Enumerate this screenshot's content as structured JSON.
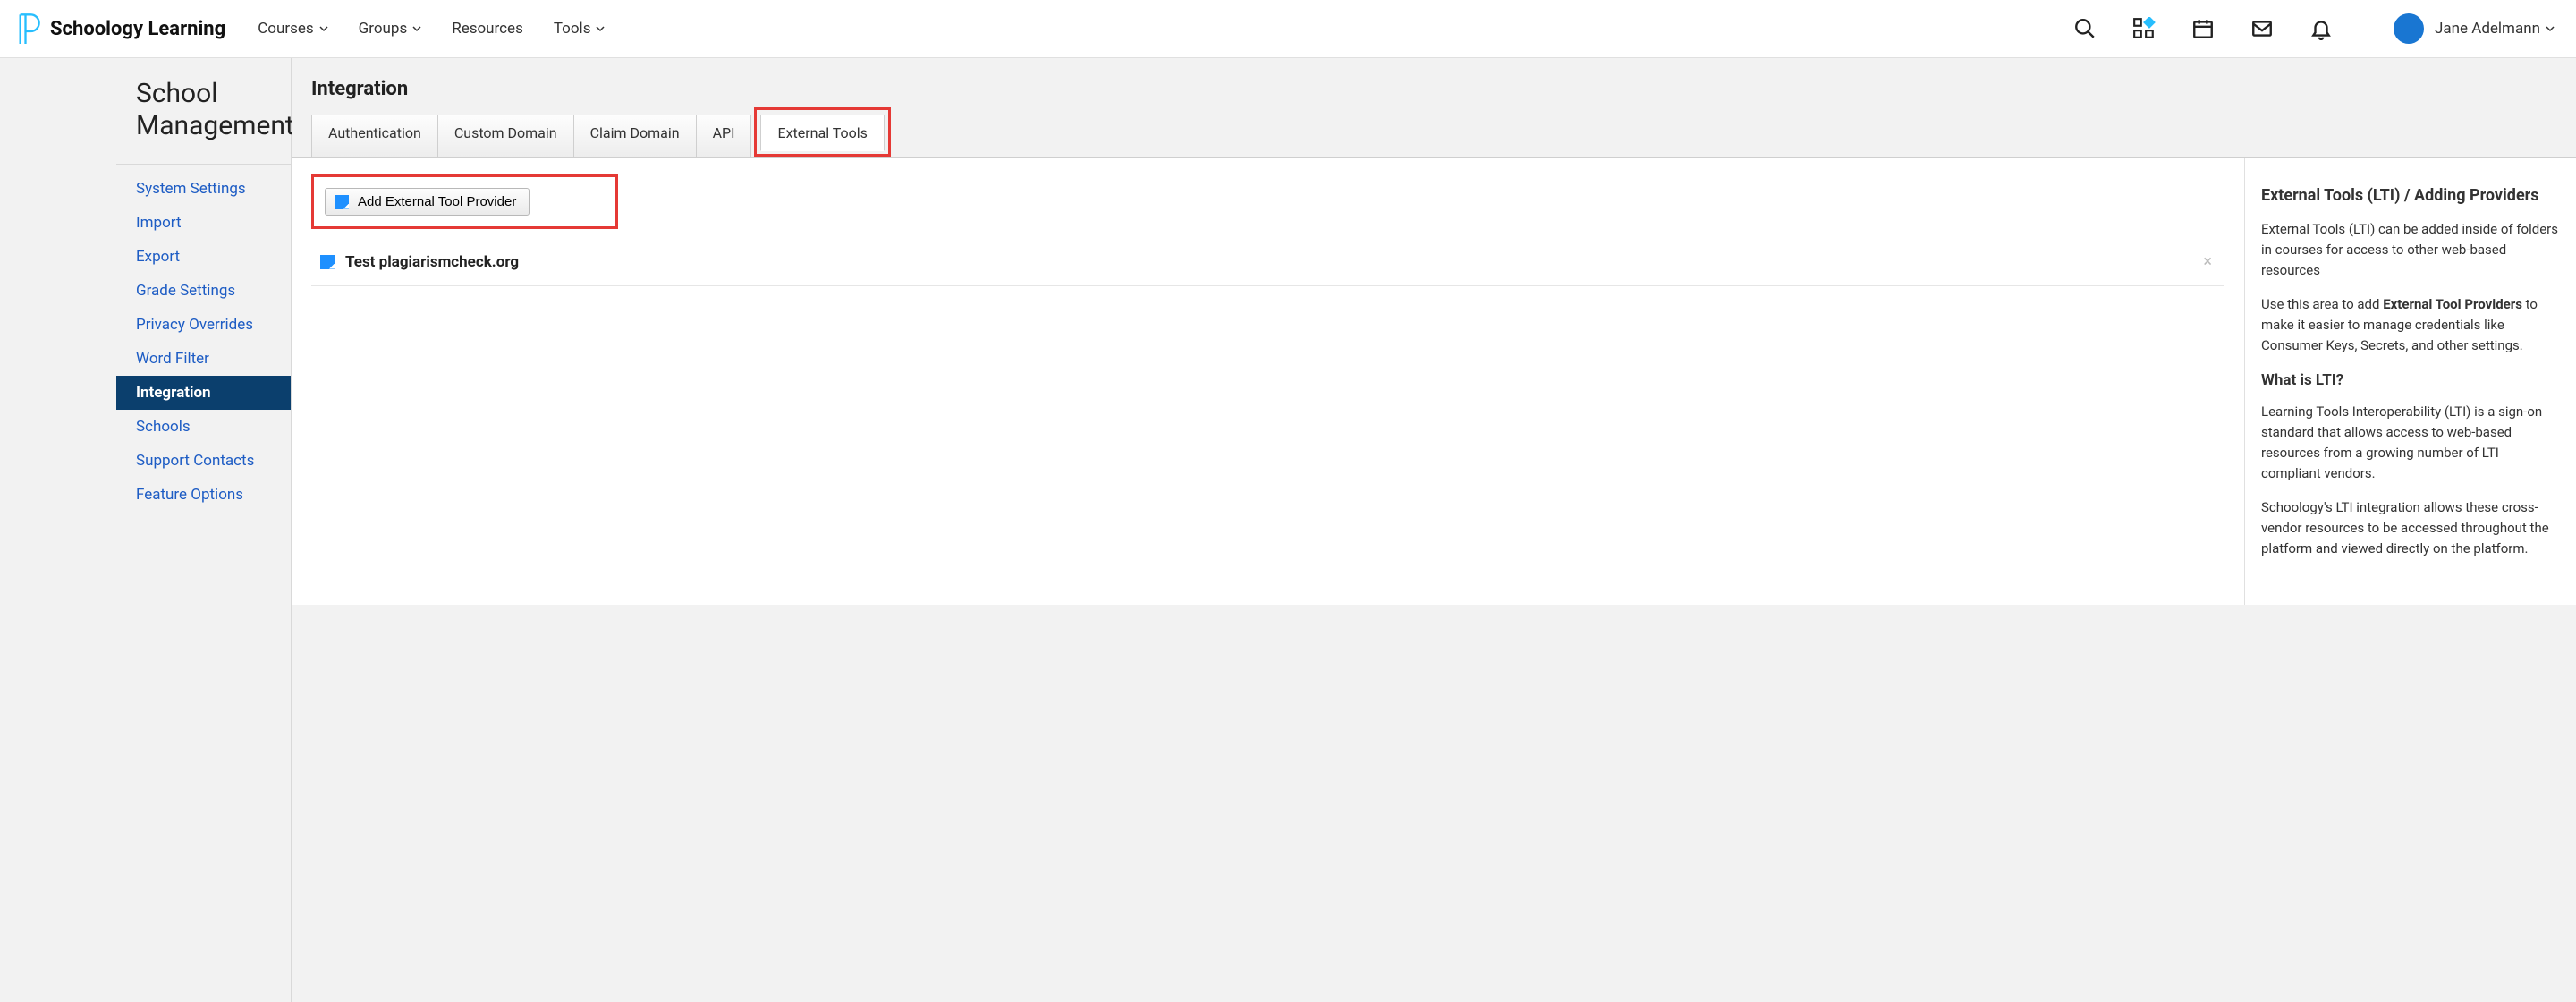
{
  "brand": {
    "text": "Schoology Learning"
  },
  "top_nav": {
    "courses": "Courses",
    "groups": "Groups",
    "resources": "Resources",
    "tools": "Tools"
  },
  "user": {
    "name": "Jane Adelmann"
  },
  "sidebar": {
    "title_line1": "School",
    "title_line2": "Management",
    "items": [
      {
        "label": "System Settings"
      },
      {
        "label": "Import"
      },
      {
        "label": "Export"
      },
      {
        "label": "Grade Settings"
      },
      {
        "label": "Privacy Overrides"
      },
      {
        "label": "Word Filter"
      },
      {
        "label": "Integration",
        "active": true
      },
      {
        "label": "Schools"
      },
      {
        "label": "Support Contacts"
      },
      {
        "label": "Feature Options"
      }
    ]
  },
  "main": {
    "title": "Integration",
    "tabs": [
      {
        "label": "Authentication"
      },
      {
        "label": "Custom Domain"
      },
      {
        "label": "Claim Domain"
      },
      {
        "label": "API"
      },
      {
        "label": "External Tools",
        "active": true
      }
    ],
    "add_button": "Add External Tool Provider",
    "providers": [
      {
        "label": "Test plagiarismcheck.org"
      }
    ],
    "info": {
      "title": "External Tools (LTI) / Adding Providers",
      "p1": "External Tools (LTI) can be added inside of folders in courses for access to other web-based resources",
      "p2_a": "Use this area to add ",
      "p2_b": "External Tool Providers",
      "p2_c": " to make it easier to manage credentials like Consumer Keys, Secrets, and other settings.",
      "what": "What is LTI?",
      "p3": "Learning Tools Interoperability (LTI) is a sign-on standard that allows access to web-based resources from a growing number of LTI compliant vendors.",
      "p4": "Schoology's LTI integration allows these cross-vendor resources to be accessed throughout the platform and viewed directly on the platform."
    }
  }
}
